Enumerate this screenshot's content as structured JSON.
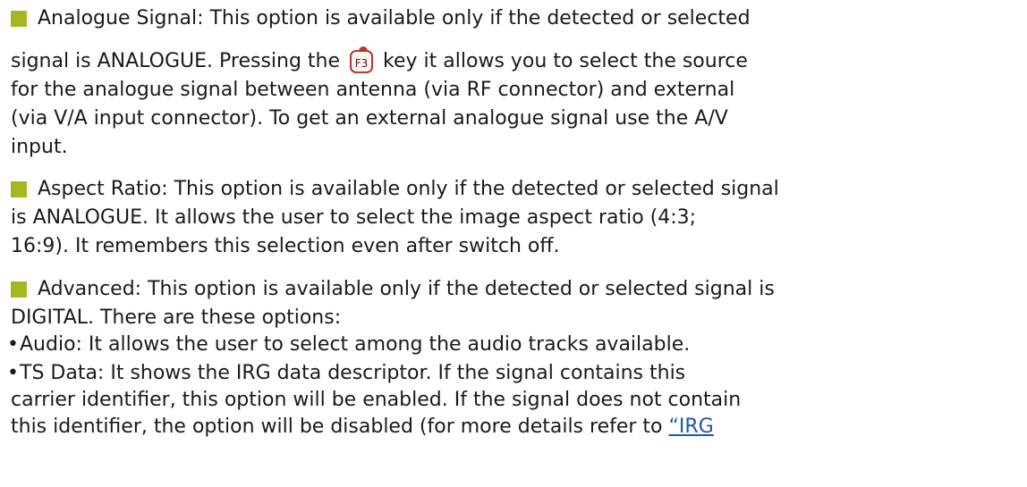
{
  "items": [
    {
      "lines": [
        "Analogue Signal: This option is available only if the detected or selected",
        "signal is ANALOGUE. Pressing the",
        "key it allows you to select the source",
        "for the analogue signal between antenna (via RF connector) and external",
        "(via V/A input connector). To get an external analogue signal use the A/V",
        "input."
      ],
      "key_label": "F3"
    },
    {
      "lines": [
        "Aspect Ratio: This option is available only if the detected or selected signal",
        "is ANALOGUE. It allows the user to select the image aspect ratio (4:3;",
        "16:9). It remembers this selection even after switch off."
      ]
    },
    {
      "lines": [
        "Advanced: This option is available only if the detected or selected signal is",
        "DIGITAL. There are these options:"
      ],
      "subitems": [
        {
          "lines": [
            "Audio: It allows the user to select among the audio tracks available."
          ]
        },
        {
          "lines": [
            "TS Data: It shows the IRG data descriptor. If the signal contains this",
            "carrier identifier, this option will be enabled. If the signal does not contain",
            "this identifier, the option will be disabled (for more details refer to"
          ],
          "link_text": "“IRG"
        }
      ]
    }
  ],
  "bullet_color": "#a6b520",
  "link_color": "#1e56a8"
}
